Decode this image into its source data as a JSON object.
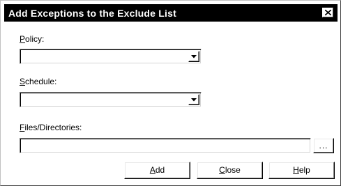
{
  "dialog": {
    "title": "Add Exceptions to the Exclude List",
    "close_glyph": "close-icon"
  },
  "policy": {
    "label": "Policy:",
    "mnemonic": "P",
    "label_rest": "olicy:",
    "value": ""
  },
  "schedule": {
    "label": "Schedule:",
    "mnemonic": "S",
    "label_rest": "chedule:",
    "value": ""
  },
  "files": {
    "label": "Files/Directories:",
    "mnemonic": "F",
    "label_rest": "iles/Directories:",
    "value": "",
    "browse_label": "..."
  },
  "buttons": {
    "add": {
      "label": "Add",
      "mnemonic": "A",
      "rest": "dd"
    },
    "close": {
      "label": "Close",
      "mnemonic": "C",
      "rest": "lose"
    },
    "help": {
      "label": "Help",
      "mnemonic": "H",
      "rest": "elp"
    }
  }
}
